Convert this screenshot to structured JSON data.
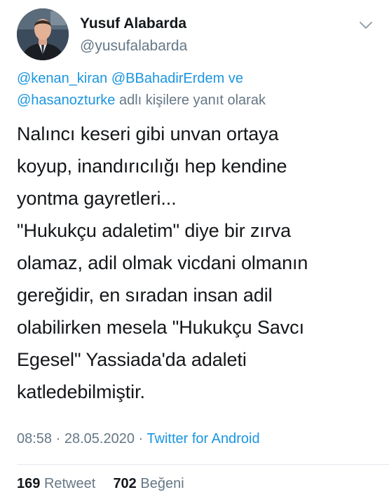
{
  "user": {
    "display_name": "Yusuf Alabarda",
    "handle": "@yusufalabarda",
    "avatar_icon": "profile-photo"
  },
  "reply": {
    "mentions": [
      "@kenan_kiran",
      "@BBahadirErdem",
      "@hasanozturke"
    ],
    "connector": "ve",
    "suffix": "adlı kişilere yanıt olarak"
  },
  "tweet": {
    "lines": [
      "Nalıncı keseri gibi unvan ortaya",
      "koyup, inandırıcılığı hep kendine",
      "yontma gayretleri...",
      "\"Hukukçu adaletim\" diye bir zırva",
      "olamaz, adil olmak vicdani olmanın",
      "gereğidir, en sıradan insan adil",
      "olabilirken mesela \"Hukukçu Savcı",
      "Egesel\" Yassiada'da adaleti",
      "katledebilmiştir."
    ]
  },
  "meta": {
    "time": "08:58",
    "separator": "·",
    "date": "28.05.2020",
    "source": "Twitter for Android"
  },
  "stats": {
    "retweets_count": "169",
    "retweets_label": "Retweet",
    "likes_count": "702",
    "likes_label": "Beğeni"
  },
  "colors": {
    "link": "#1b95e0",
    "secondary": "#657786",
    "text": "#14171a",
    "divider": "#e1e8ed"
  }
}
